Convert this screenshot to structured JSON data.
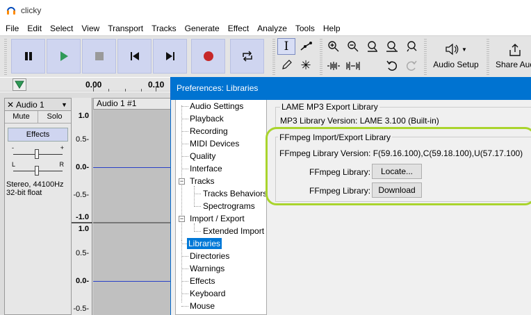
{
  "window": {
    "title": "clicky"
  },
  "menu": [
    "File",
    "Edit",
    "Select",
    "View",
    "Transport",
    "Tracks",
    "Generate",
    "Effect",
    "Analyze",
    "Tools",
    "Help"
  ],
  "toolbar": {
    "transport_icons": [
      "pause-icon",
      "play-icon",
      "stop-icon",
      "skip-to-start-icon",
      "skip-to-end-icon",
      "record-icon",
      "loop-icon"
    ],
    "audio_setup_label": "Audio Setup",
    "share_audio_label": "Share Aud"
  },
  "timeline": {
    "labels": [
      "0.00",
      "0.10"
    ]
  },
  "track": {
    "name": "Audio 1",
    "mute_label": "Mute",
    "solo_label": "Solo",
    "effects_label": "Effects",
    "gain_minus": "-",
    "gain_plus": "+",
    "pan_left": "L",
    "pan_right": "R",
    "info_line1": "Stereo, 44100Hz",
    "info_line2": "32-bit float",
    "clip_name": "Audio 1 #1",
    "ruler_top": [
      "1.0",
      "0.5-",
      "0.0-",
      "-0.5-",
      "-1.0"
    ],
    "ruler_bottom": [
      "1.0",
      "0.5-",
      "0.0-",
      "-0.5-"
    ]
  },
  "dialog": {
    "title": "Preferences: Libraries",
    "tree": [
      "Audio Settings",
      "Playback",
      "Recording",
      "MIDI Devices",
      "Quality",
      "Interface",
      "Tracks",
      "Tracks Behaviors",
      "Spectrograms",
      "Import / Export",
      "Extended Import",
      "Libraries",
      "Directories",
      "Warnings",
      "Effects",
      "Keyboard",
      "Mouse"
    ],
    "lame_group_title": "LAME MP3 Export Library",
    "mp3_version": "MP3 Library Version: LAME 3.100 (Built-in)",
    "ffmpeg_group_title": "FFmpeg Import/Export Library",
    "ffmpeg_version": "FFmpeg Library Version: F(59.16.100),C(59.18.100),U(57.17.100)",
    "ffmpeg_library_label_1": "FFmpeg Library:",
    "locate_button": "Locate...",
    "ffmpeg_library_label_2": "FFmpeg Library:",
    "download_button": "Download"
  },
  "colors": {
    "dialog_title_bg": "#0073d1",
    "selected_item_bg": "#0078d7",
    "highlight_outline": "#a9d42d",
    "waveform_line": "#2840c8",
    "transport_button_bg": "#cfd5f0"
  }
}
